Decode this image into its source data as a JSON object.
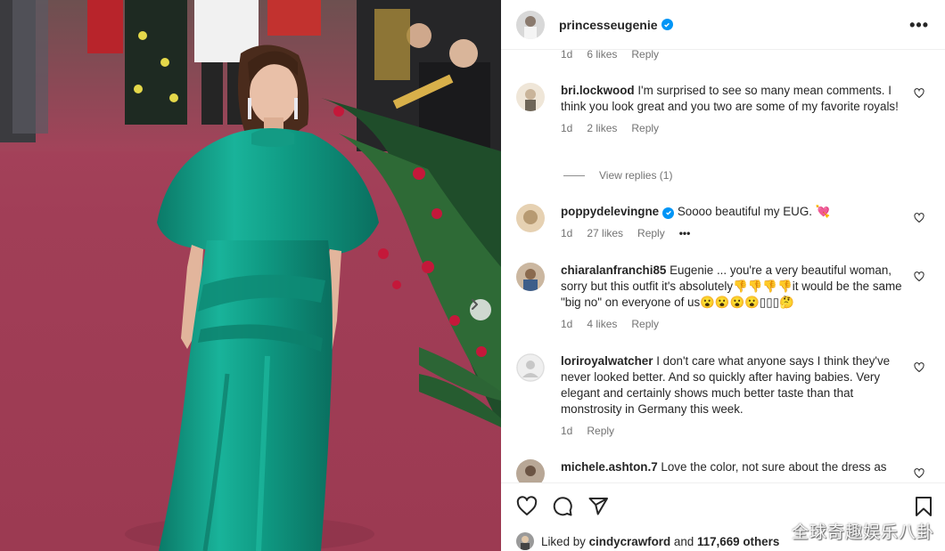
{
  "post": {
    "author": "princesseugenie",
    "verified": true
  },
  "colors": {
    "verified": "#0095f6",
    "text_primary": "#262626",
    "text_secondary": "#737373",
    "dress": "#12a088",
    "carpet": "#a13e57"
  },
  "comments": {
    "truncated_meta": {
      "time": "1d",
      "likes": "6 likes",
      "reply": "Reply"
    },
    "items": [
      {
        "username": "bri.lockwood",
        "text": "I'm surprised to see so many mean comments. I think you look great and you two are some of my favorite royals!",
        "time": "1d",
        "likes": "2 likes",
        "reply": "Reply",
        "view_replies": "View replies (1)"
      },
      {
        "username": "poppydelevingne",
        "verified": true,
        "text": "Soooo beautiful my EUG. 💘",
        "time": "1d",
        "likes": "27 likes",
        "reply": "Reply",
        "more": "•••"
      },
      {
        "username": "chiaralanfranchi85",
        "text": "Eugenie ... you're a very beautiful woman, sorry but this outfit it's absolutely👎👎👎👎it would be the same \"big no\" on everyone of us😮😮😮😮▯▯▯🤔",
        "time": "1d",
        "likes": "4 likes",
        "reply": "Reply"
      },
      {
        "username": "loriroyalwatcher",
        "text": "I don't care what anyone says I think they've never looked better. And so quickly after having babies. Very elegant and certainly shows much better taste than that monstrosity in Germany this week.",
        "time": "1d",
        "reply": "Reply"
      },
      {
        "username": "michele.ashton.7",
        "text": "Love the color, not sure about the dress as"
      }
    ]
  },
  "actions": {
    "icons": [
      "heart-icon",
      "comment-icon",
      "share-icon",
      "bookmark-icon"
    ]
  },
  "likes": {
    "prefix": "Liked by",
    "user": "cindycrawford",
    "and": "and",
    "count": "117,669 others"
  },
  "watermark": "全球奇趣娱乐八卦"
}
